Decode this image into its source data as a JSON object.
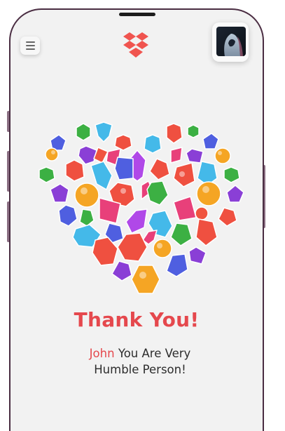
{
  "app": {
    "menu_icon": "hamburger-menu-icon",
    "logo_icon": "dropbox-logo-icon",
    "brand_color": "#f0544f",
    "avatar_icon": "hooded-figure-avatar"
  },
  "card": {
    "title": "Thank You!",
    "name": "John",
    "message": "You Are Very Humble Person!",
    "title_color": "#e5484d"
  },
  "illustration": {
    "icon": "gem-heart-illustration"
  }
}
